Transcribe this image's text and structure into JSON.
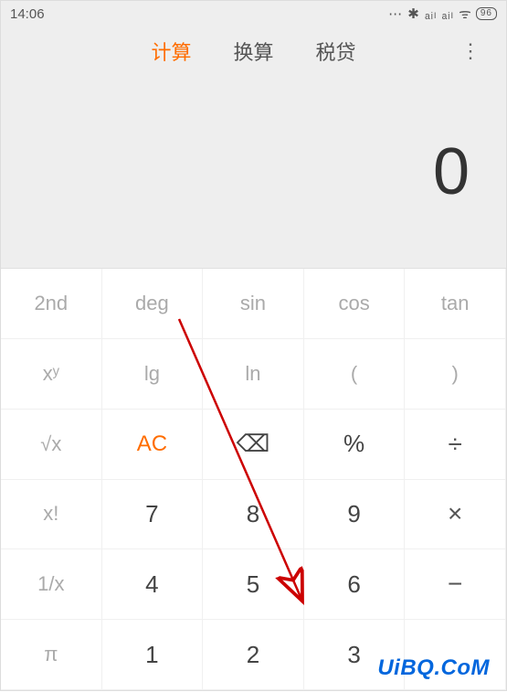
{
  "status": {
    "time": "14:06",
    "icons": "⋯ ✱ ₐᵢₗ ₐᵢₗ ᯤ",
    "battery": "96"
  },
  "tabs": {
    "calc": "计算",
    "convert": "换算",
    "tax": "税贷"
  },
  "display": {
    "value": "0"
  },
  "keys": {
    "r1c1": "2nd",
    "r1c2": "deg",
    "r1c3": "sin",
    "r1c4": "cos",
    "r1c5": "tan",
    "r2c1": "xʸ",
    "r2c2": "lg",
    "r2c3": "ln",
    "r2c4": "(",
    "r2c5": ")",
    "r3c1": "√x",
    "r3c2": "AC",
    "r3c3": "⌫",
    "r3c4": "%",
    "r3c5": "÷",
    "r4c1": "x!",
    "r4c2": "7",
    "r4c3": "8",
    "r4c4": "9",
    "r4c5": "×",
    "r5c1": "1/x",
    "r5c2": "4",
    "r5c3": "5",
    "r5c4": "6",
    "r5c5": "−",
    "r6c1": "π",
    "r6c2": "1",
    "r6c3": "2",
    "r6c4": "3"
  },
  "watermark": "UiBQ.CoM"
}
